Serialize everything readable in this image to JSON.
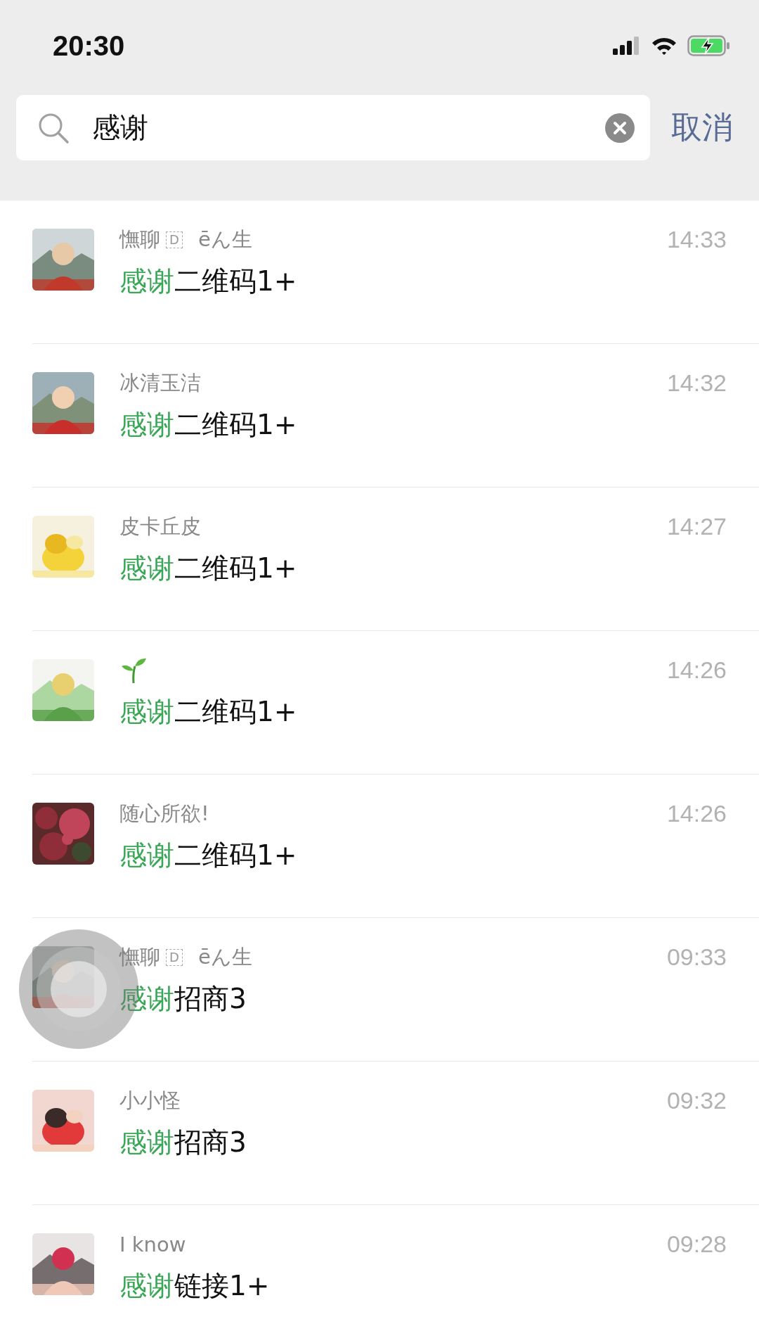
{
  "status_bar": {
    "time": "20:30",
    "charging": true
  },
  "search": {
    "value": "感谢",
    "cancel": "取消"
  },
  "results": [
    {
      "kind": "text",
      "name": "憮聊",
      "badge": "D",
      "name_rest": "ēん生",
      "match": "感谢",
      "rest": "二维码1+",
      "time": "14:33"
    },
    {
      "kind": "text",
      "name": "冰清玉洁",
      "match": "感谢",
      "rest": "二维码1+",
      "time": "14:32"
    },
    {
      "kind": "text",
      "name": "皮卡丘皮",
      "match": "感谢",
      "rest": "二维码1+",
      "time": "14:27"
    },
    {
      "kind": "sprout",
      "match": "感谢",
      "rest": "二维码1+",
      "time": "14:26"
    },
    {
      "kind": "text",
      "name": "随心所欲!",
      "match": "感谢",
      "rest": "二维码1+",
      "time": "14:26"
    },
    {
      "kind": "text",
      "name": "憮聊",
      "badge": "D",
      "name_rest": "ēん生",
      "match": "感谢",
      "rest": "招商3",
      "time": "09:33"
    },
    {
      "kind": "text",
      "name": "小小怪",
      "match": "感谢",
      "rest": "招商3",
      "time": "09:32"
    },
    {
      "kind": "text",
      "name": "I know",
      "match": "感谢",
      "rest": "链接1+",
      "time": "09:28"
    }
  ]
}
